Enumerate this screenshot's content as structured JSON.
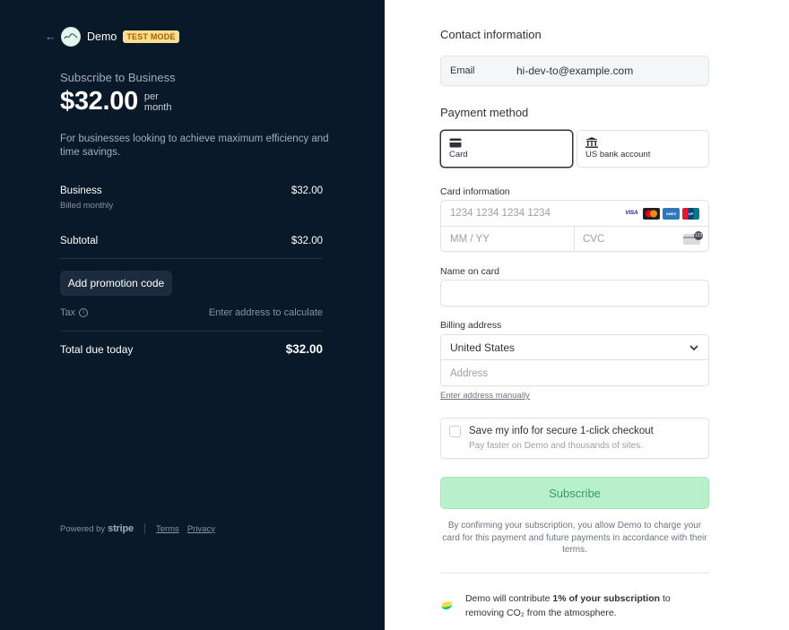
{
  "header": {
    "brand_name": "Demo",
    "badge": "TEST MODE"
  },
  "summary": {
    "subscribe_title": "Subscribe to Business",
    "price": "$32.00",
    "period_line1": "per",
    "period_line2": "month",
    "description": "For businesses looking to achieve maximum efficiency and time savings.",
    "item_name": "Business",
    "item_amount": "$32.00",
    "item_billing": "Billed monthly",
    "subtotal_label": "Subtotal",
    "subtotal_amount": "$32.00",
    "promo_button": "Add promotion code",
    "tax_label": "Tax",
    "tax_value": "Enter address to calculate",
    "total_label": "Total due today",
    "total_amount": "$32.00"
  },
  "footer": {
    "powered_by": "Powered by",
    "stripe": "stripe",
    "terms": "Terms",
    "privacy": "Privacy"
  },
  "contact": {
    "title": "Contact information",
    "email_label": "Email",
    "email_value": "hi-dev-to@example.com"
  },
  "payment": {
    "title": "Payment method",
    "tab_card": "Card",
    "tab_bank": "US bank account",
    "card_info_label": "Card information",
    "card_number_placeholder": "1234 1234 1234 1234",
    "expiry_placeholder": "MM / YY",
    "cvc_placeholder": "CVC",
    "card_brands": [
      "VISA",
      "mastercard",
      "amex",
      "unionpay"
    ]
  },
  "name_on_card": {
    "label": "Name on card",
    "value": ""
  },
  "billing": {
    "label": "Billing address",
    "country": "United States",
    "address_placeholder": "Address",
    "manual_link": "Enter address manually"
  },
  "save_info": {
    "title": "Save my info for secure 1-click checkout",
    "subtitle": "Pay faster on Demo and thousands of sites."
  },
  "subscribe_button": "Subscribe",
  "terms_text": "By confirming your subscription, you allow Demo to charge your card for this payment and future payments in accordance with their terms.",
  "climate": {
    "text_before": "Demo will contribute",
    "text_bold": "1% of your subscription",
    "text_after": "to removing CO₂ from the atmosphere."
  },
  "colors": {
    "left_bg": "#0a1929",
    "badge_bg": "#ffde92",
    "subscribe_bg": "#b7f0ca"
  }
}
